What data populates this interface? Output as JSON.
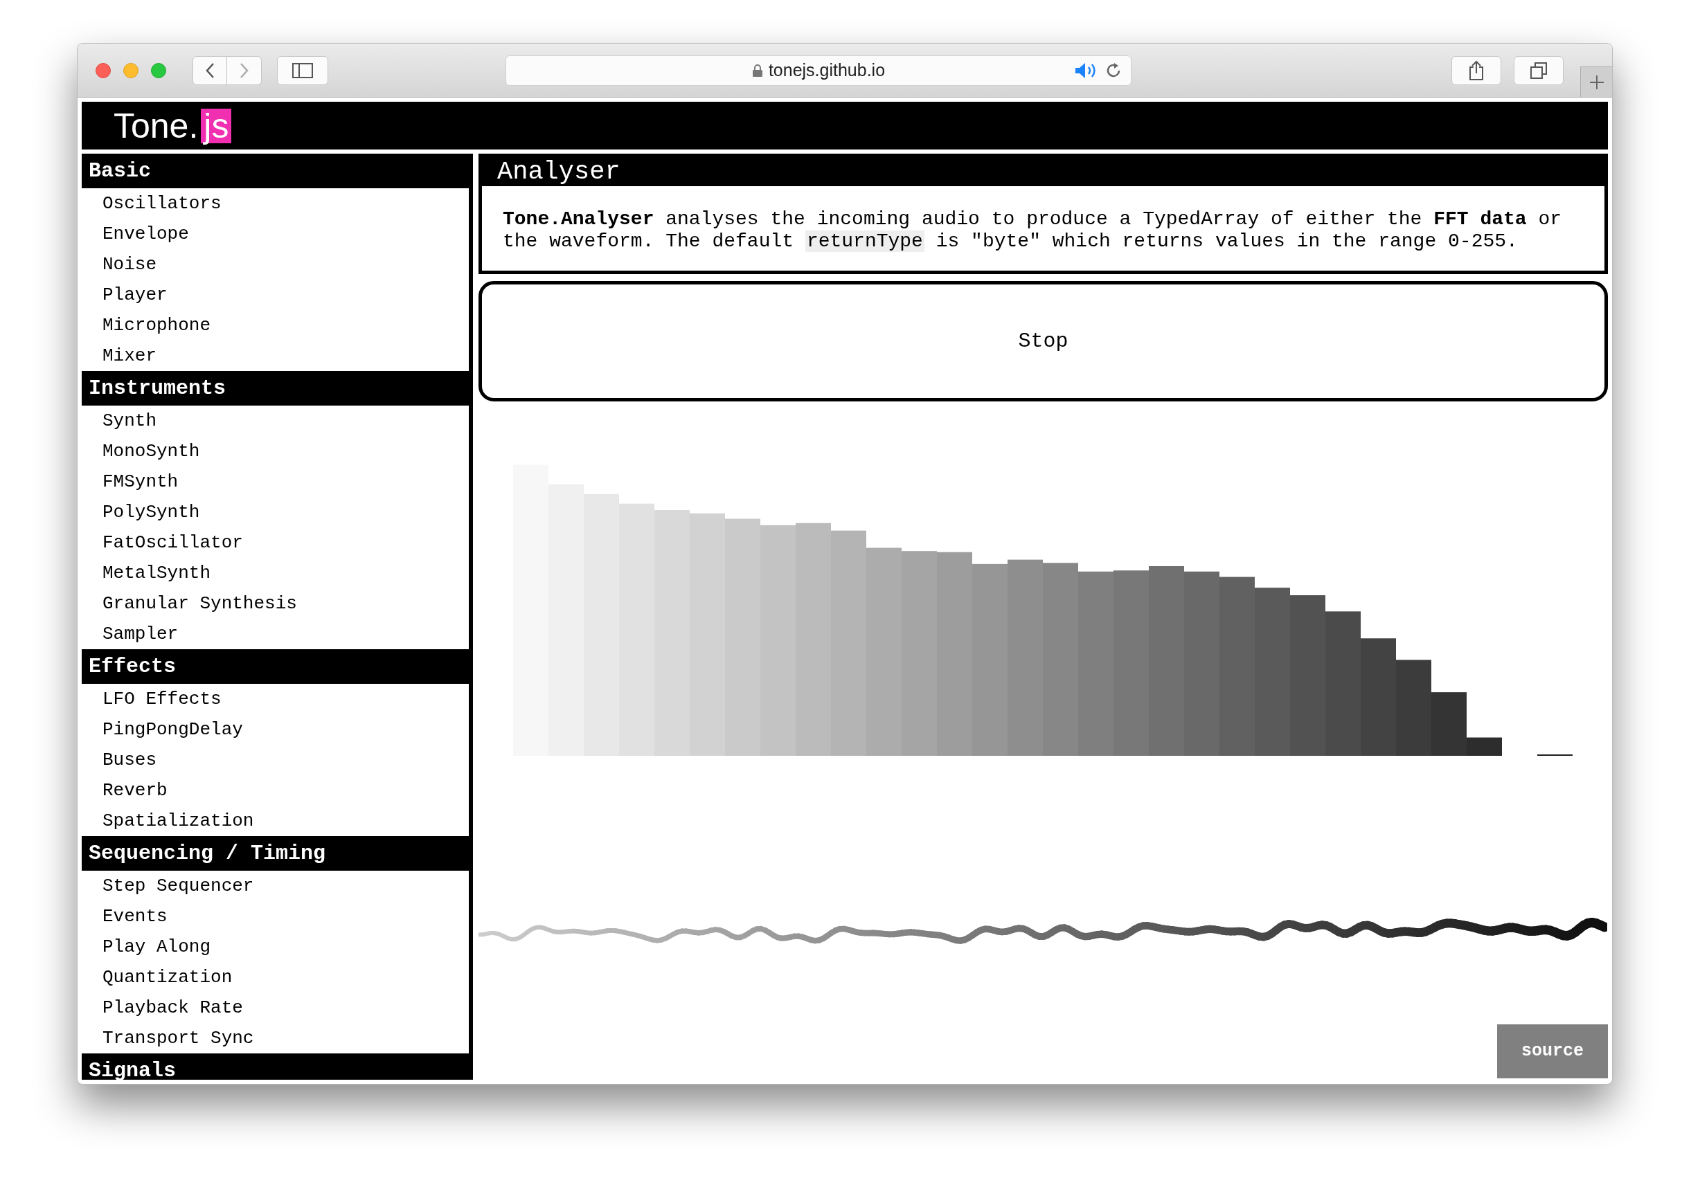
{
  "browser": {
    "url": "tonejs.github.io"
  },
  "logo": {
    "text": "Tone.",
    "highlight": "js"
  },
  "sidebar": {
    "sections": [
      {
        "title": "Basic",
        "items": [
          "Oscillators",
          "Envelope",
          "Noise",
          "Player",
          "Microphone",
          "Mixer"
        ]
      },
      {
        "title": "Instruments",
        "items": [
          "Synth",
          "MonoSynth",
          "FMSynth",
          "PolySynth",
          "FatOscillator",
          "MetalSynth",
          "Granular Synthesis",
          "Sampler"
        ]
      },
      {
        "title": "Effects",
        "items": [
          "LFO Effects",
          "PingPongDelay",
          "Buses",
          "Reverb",
          "Spatialization"
        ]
      },
      {
        "title": "Sequencing / Timing",
        "items": [
          "Step Sequencer",
          "Events",
          "Play Along",
          "Quantization",
          "Playback Rate",
          "Transport Sync"
        ]
      },
      {
        "title": "Signals"
      }
    ]
  },
  "example": {
    "title": "Analyser",
    "description": {
      "before": "**Tone.Analyser** analyses the incoming audio to produce a TypedArray of either the **FFT data** or the waveform. The default ",
      "code": "returnType",
      "after": " is \"byte\" which returns values in the range 0-255."
    }
  },
  "play_button": {
    "label": "Stop"
  },
  "source_button": {
    "label": "source"
  }
}
